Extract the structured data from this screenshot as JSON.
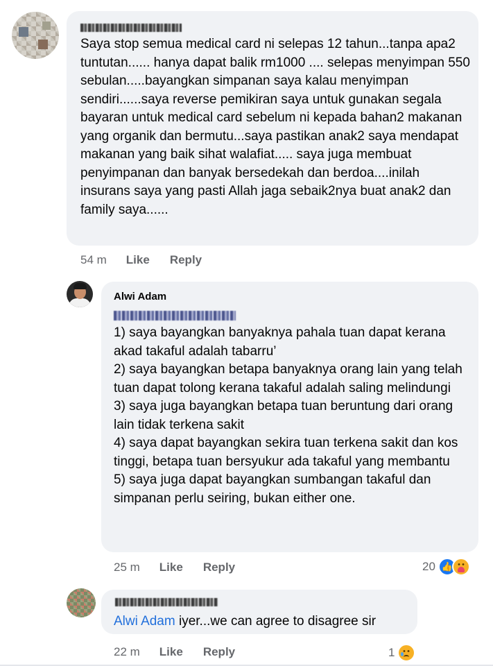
{
  "comments": [
    {
      "author": "",
      "text": "Saya stop semua medical card ni selepas 12 tahun...tanpa apa2 tuntutan...... hanya dapat balik rm1000 .... selepas menyimpan 550 sebulan.....bayangkan simpanan saya kalau menyimpan sendiri......saya reverse pemikiran saya untuk gunakan segala bayaran untuk medical card sebelum ni kepada bahan2 makanan yang organik dan bermutu...saya pastikan anak2 saya mendapat makanan yang baik sihat walafiat..... saya juga membuat penyimpanan dan banyak bersedekah dan berdoa....inilah insurans saya yang pasti Allah jaga sebaik2nya buat anak2 dan family saya......",
      "time": "54 m",
      "like_label": "Like",
      "reply_label": "Reply"
    },
    {
      "author": "Alwi Adam",
      "text": "1) saya bayangkan banyaknya pahala tuan dapat kerana akad takaful adalah tabarru’\n2) saya bayangkan betapa banyaknya orang lain yang telah tuan dapat tolong kerana takaful adalah saling melindungi\n3) saya juga bayangkan betapa tuan beruntung dari orang lain tidak terkena sakit\n4) saya dapat bayangkan sekira tuan terkena sakit dan kos tinggi, betapa tuan bersyukur ada takaful yang membantu\n5) saya juga dapat bayangkan sumbangan takaful dan simpanan perlu seiring, bukan either one.",
      "time": "25 m",
      "like_label": "Like",
      "reply_label": "Reply",
      "reaction_count": "20",
      "reaction_icons": [
        "like-icon",
        "care-icon"
      ]
    },
    {
      "author": "",
      "mention": "Alwi Adam",
      "text": " iyer...we can agree to disagree sir",
      "time": "22 m",
      "like_label": "Like",
      "reply_label": "Reply",
      "reaction_count": "1",
      "reaction_icons": [
        "sad-icon"
      ]
    }
  ],
  "colors": {
    "bubble": "#f0f2f5",
    "mention": "#216fdb",
    "meta": "#65676b",
    "like": "#1877f2"
  }
}
